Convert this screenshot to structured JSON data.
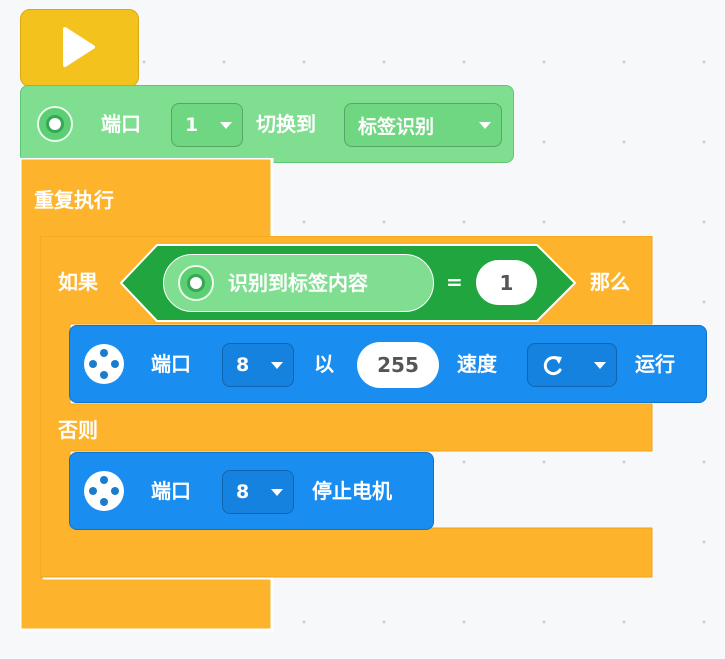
{
  "colors": {
    "hat": "#f4c21d",
    "control": "#fdb42c",
    "sensor": "#7fde8f",
    "condition": "#21a53e",
    "motor": "#1a8df0"
  },
  "hat_block": {
    "icon": "play-icon"
  },
  "sensor_switch": {
    "port_label": "端口",
    "port_value": "1",
    "switch_label": "切换到",
    "mode_value": "标签识别",
    "icon": "color-sensor-icon"
  },
  "repeat": {
    "label": "重复执行"
  },
  "if_else": {
    "if_label": "如果",
    "then_label": "那么",
    "else_label": "否则",
    "condition": {
      "reporter_label": "识别到标签内容",
      "operator": "=",
      "value": "1",
      "icon": "color-sensor-icon"
    }
  },
  "motor_run": {
    "port_label": "端口",
    "port_value": "8",
    "with_label": "以",
    "speed_value": "255",
    "speed_label": "速度",
    "direction_icon": "clockwise-arrow-icon",
    "run_label": "运行",
    "icon": "motor-icon"
  },
  "motor_stop": {
    "port_label": "端口",
    "port_value": "8",
    "action_label": "停止电机",
    "icon": "motor-icon"
  }
}
